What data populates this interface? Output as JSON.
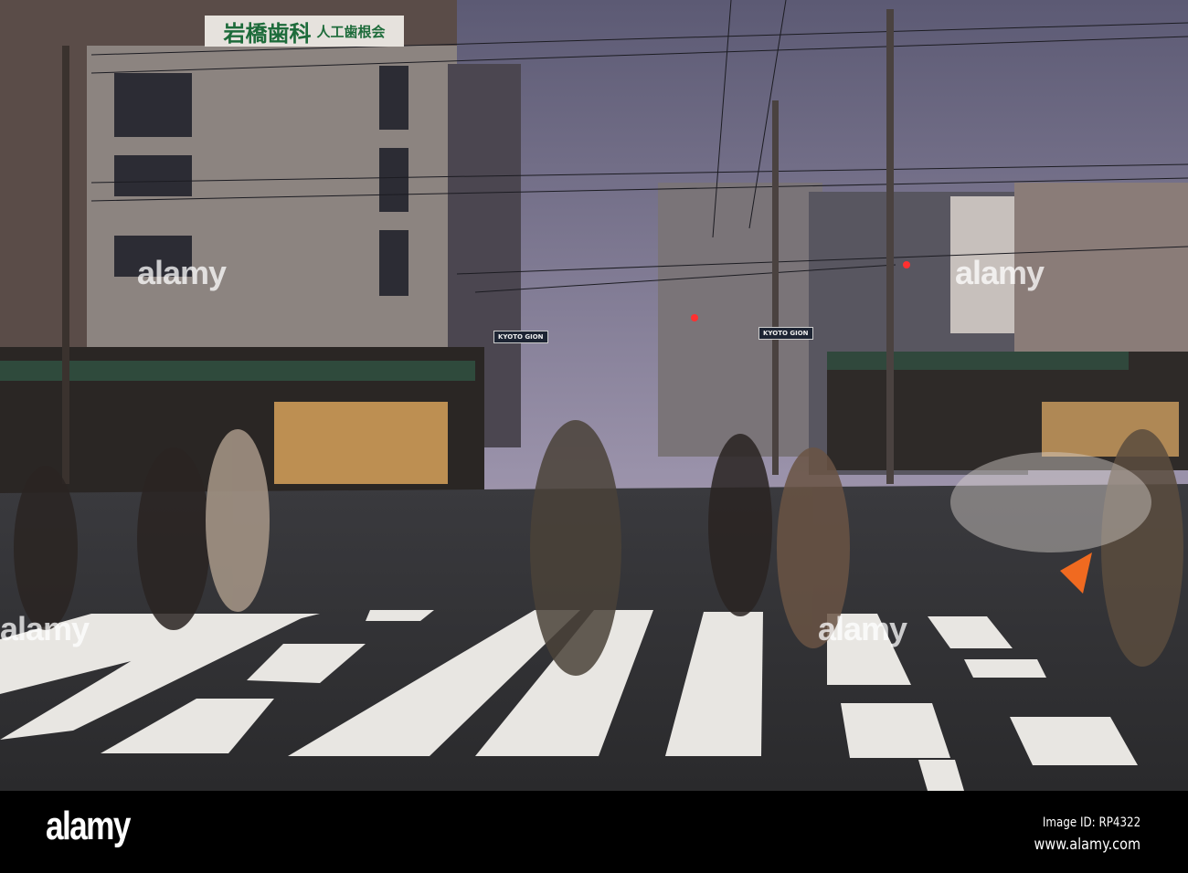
{
  "photo": {
    "description_sign": {
      "main": "岩橋歯科",
      "sub": "人工歯根会"
    },
    "street_signs": [
      "KYOTO GION",
      "KYOTO GION"
    ]
  },
  "watermark": {
    "text": "alamy"
  },
  "footer": {
    "logo": "alamy",
    "image_id": "Image ID: RP4322",
    "url": "www.alamy.com"
  }
}
